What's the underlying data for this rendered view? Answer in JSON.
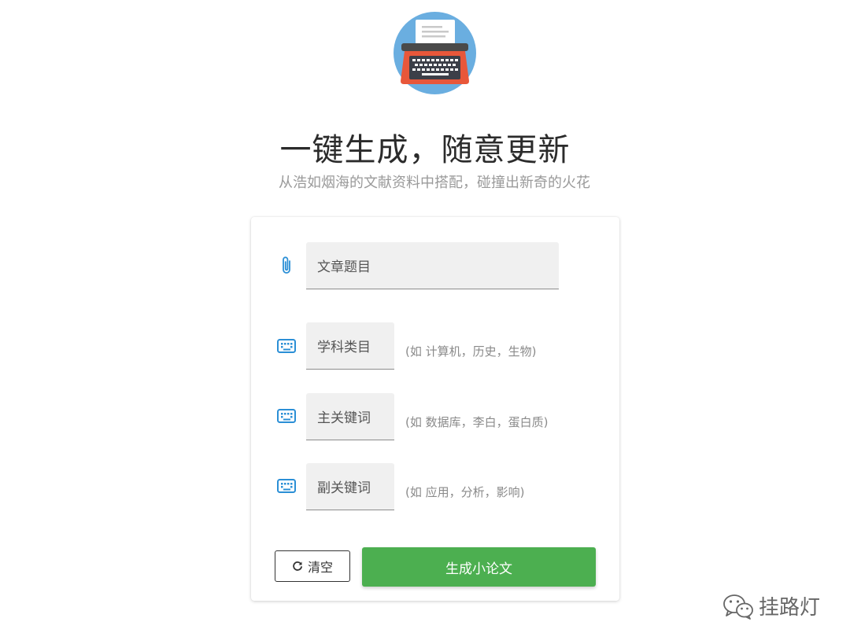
{
  "header": {
    "logo_icon": "typewriter-icon",
    "title": "一键生成，随意更新",
    "subtitle": "从浩如烟海的文献资料中搭配，碰撞出新奇的火花"
  },
  "form": {
    "title_field": {
      "icon": "paperclip-icon",
      "placeholder": "文章题目"
    },
    "subject_field": {
      "icon": "keyboard-icon",
      "placeholder": "学科类目",
      "hint": "(如 计算机，历史，生物)"
    },
    "main_keyword_field": {
      "icon": "keyboard-icon",
      "placeholder": "主关键词",
      "hint": "(如 数据库，李白，蛋白质)"
    },
    "sub_keyword_field": {
      "icon": "keyboard-icon",
      "placeholder": "副关键词",
      "hint": "(如 应用，分析，影响)"
    },
    "clear_button": {
      "icon": "refresh-icon",
      "label": "清空"
    },
    "generate_button": {
      "label": "生成小论文"
    }
  },
  "watermark": {
    "icon": "wechat-icon",
    "text": "挂路灯"
  },
  "colors": {
    "accent": "#4caf50",
    "icon_blue": "#2b8fd6",
    "field_bg": "#f0f0f0"
  }
}
